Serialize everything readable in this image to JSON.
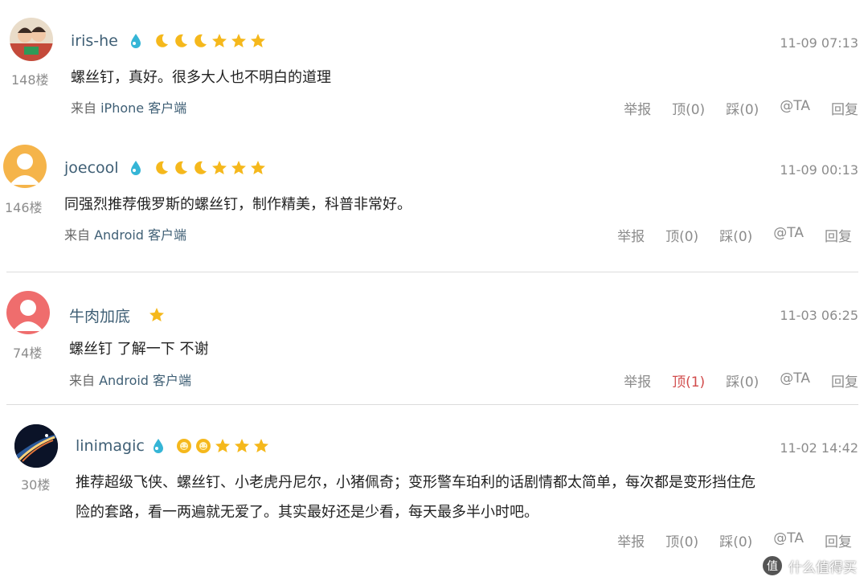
{
  "comments": [
    {
      "user": "iris-he",
      "floor": "148楼",
      "time": "11-09 07:13",
      "content": "螺丝钉，真好。很多大人也不明白的道理",
      "source_prefix": "来自 ",
      "device": "iPhone 客户端",
      "badges": [
        "drop",
        "moon",
        "moon",
        "moon",
        "star",
        "star",
        "star"
      ],
      "actions": [
        "举报",
        "顶(0)",
        "踩(0)",
        "@TA",
        "回复"
      ]
    },
    {
      "user": "joecool",
      "floor": "146楼",
      "time": "11-09 00:13",
      "content": "同强烈推荐俄罗斯的螺丝钉，制作精美，科普非常好。",
      "source_prefix": "来自 ",
      "device": "Android 客户端",
      "badges": [
        "drop",
        "moon",
        "moon",
        "moon",
        "star",
        "star",
        "star"
      ],
      "actions": [
        "举报",
        "顶(0)",
        "踩(0)",
        "@TA",
        "回复"
      ]
    },
    {
      "user": "牛肉加底",
      "floor": "74楼",
      "time": "11-03 06:25",
      "content": "螺丝钉 了解一下 不谢",
      "source_prefix": "来自 ",
      "device": "Android 客户端",
      "badges": [
        "star"
      ],
      "actions": [
        "举报",
        "顶(1)",
        "踩(0)",
        "@TA",
        "回复"
      ]
    },
    {
      "user": "linimagic",
      "floor": "30楼",
      "time": "11-02 14:42",
      "content_lines": [
        "推荐超级飞侠、螺丝钉、小老虎丹尼尔，小猪佩奇；变形警车珀利的话剧情都太简单，每次都是变形挡住危",
        "险的套路，看一两遍就无爱了。其实最好还是少看，每天最多半小时吧。"
      ],
      "badges": [
        "drop",
        "sun",
        "sun",
        "star",
        "star",
        "star"
      ],
      "actions": [
        "举报",
        "顶(0)",
        "踩(0)",
        "@TA",
        "回复"
      ]
    }
  ],
  "watermark": {
    "icon": "值",
    "text": "什么值得买"
  },
  "colors": {
    "username": "#3f5f75",
    "meta": "#8c8c8c",
    "badge_gold": "#f5b81c",
    "badge_drop": "#35b5d6",
    "active_up": "#d14b4b"
  },
  "avatars": [
    "photo-two-kids",
    "default-orange",
    "default-red",
    "photo-space-eclipse"
  ]
}
